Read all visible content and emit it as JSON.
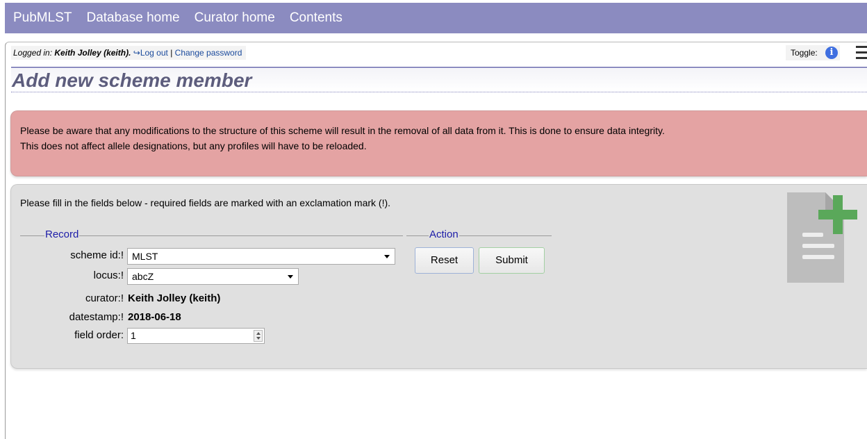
{
  "nav": {
    "items": [
      "PubMLST",
      "Database home",
      "Curator home",
      "Contents"
    ]
  },
  "login": {
    "prefix": "Logged in: ",
    "user": "Keith Jolley (keith).",
    "logout": "Log out",
    "separator": " | ",
    "change_password": "Change password"
  },
  "toggle": {
    "label": "Toggle:",
    "icon": "info-icon"
  },
  "page_title": "Add new scheme member",
  "warning": {
    "line1": "Please be aware that any modifications to the structure of this scheme will result in the removal of all data from it. This is done to ensure data integrity.",
    "line2": "This does not affect allele designations, but any profiles will have to be reloaded."
  },
  "form": {
    "instructions": "Please fill in the fields below - required fields are marked with an exclamation mark (!).",
    "record_legend": "Record",
    "action_legend": "Action",
    "fields": {
      "scheme_id": {
        "label": "scheme id:!",
        "value": "MLST"
      },
      "locus": {
        "label": "locus:!",
        "value": "abcZ"
      },
      "curator": {
        "label": "curator:!",
        "value": "Keith Jolley (keith)"
      },
      "datestamp": {
        "label": "datestamp:!",
        "value": "2018-06-18"
      },
      "field_order": {
        "label": "field order:",
        "value": "1"
      }
    },
    "reset_label": "Reset",
    "submit_label": "Submit"
  },
  "colors": {
    "nav_bg": "#8b8bc0",
    "title_text": "#5d5d7d",
    "warning_bg": "#e4a3a3",
    "panel_bg": "#e0e0e0",
    "legend_text": "#1c1ca8",
    "add_icon_green": "#5aa85a"
  }
}
